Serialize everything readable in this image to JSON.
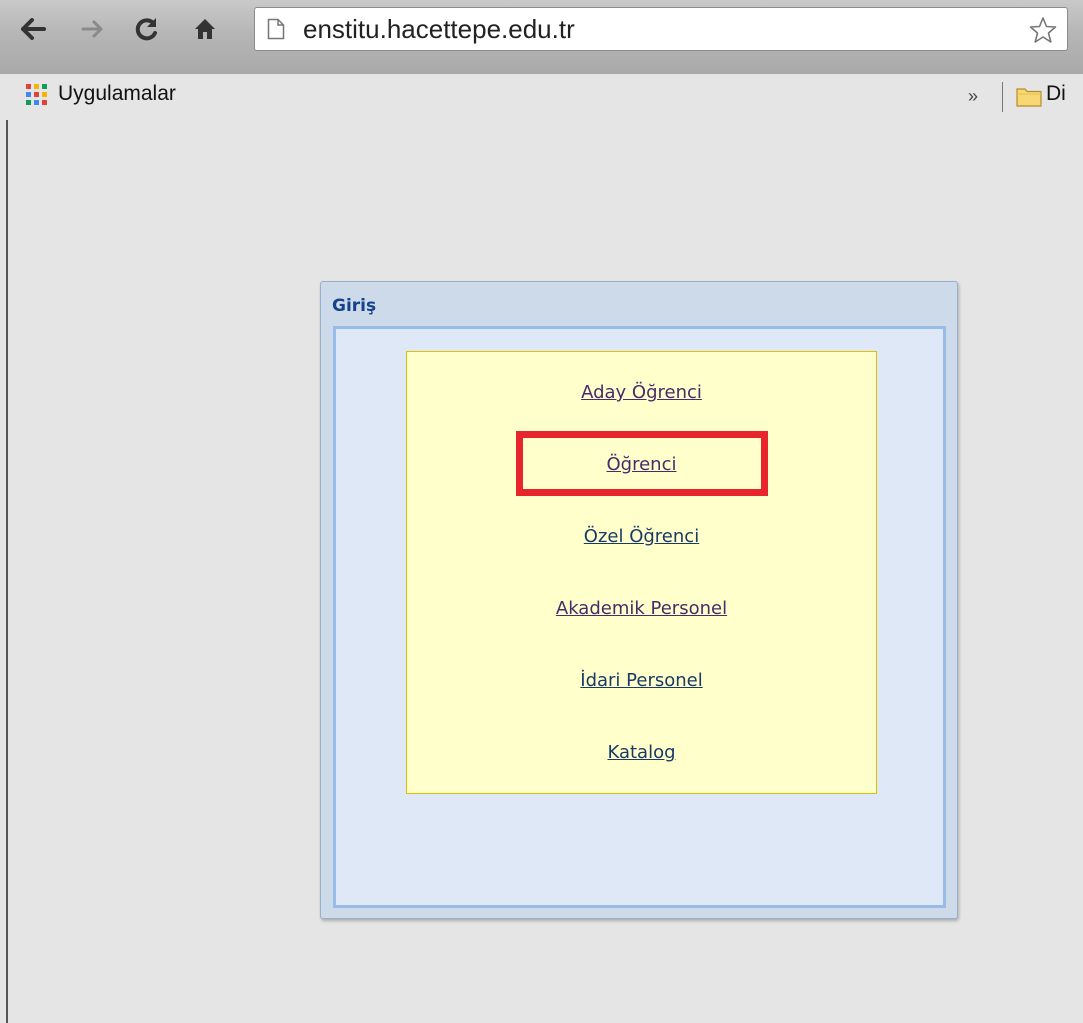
{
  "browser": {
    "url": "enstitu.hacettepe.edu.tr",
    "bookmarks": {
      "apps_label": "Uygulamalar",
      "overflow_label": "»",
      "folder_label": "Di"
    },
    "icons": {
      "back": "back-arrow-icon",
      "forward": "forward-arrow-icon",
      "reload": "reload-icon",
      "home": "home-icon",
      "page": "page-icon",
      "star": "star-icon",
      "apps": "apps-grid-icon",
      "folder": "folder-icon"
    }
  },
  "login_panel": {
    "title": "Giriş",
    "links": [
      {
        "label": "Aday Öğrenci"
      },
      {
        "label": "Öğrenci"
      },
      {
        "label": "Özel Öğrenci"
      },
      {
        "label": "Akademik Personel"
      },
      {
        "label": "İdari Personel"
      },
      {
        "label": "Katalog"
      }
    ],
    "highlight_color": "#e8242c"
  }
}
